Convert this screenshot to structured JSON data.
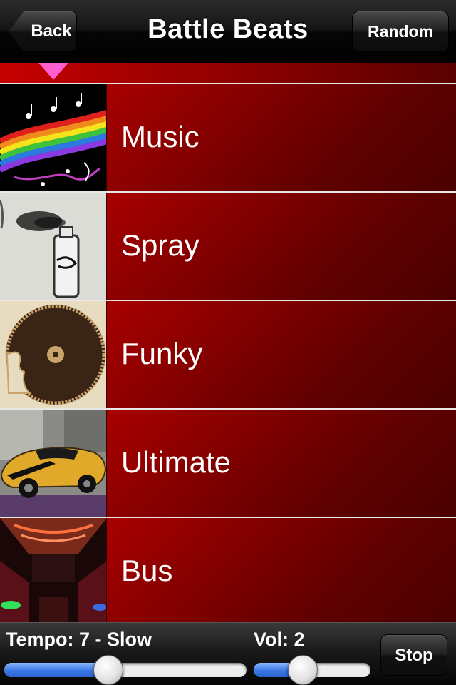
{
  "navbar": {
    "title": "Battle Beats",
    "back_label": "Back",
    "random_label": "Random"
  },
  "list": {
    "items": [
      {
        "label": "Music",
        "image": "rainbow-music-notes-image"
      },
      {
        "label": "Spray",
        "image": "spray-can-graffiti-image"
      },
      {
        "label": "Funky",
        "image": "funky-vinyl-record-face-image"
      },
      {
        "label": "Ultimate",
        "image": "yellow-sports-car-image"
      },
      {
        "label": "Bus",
        "image": "party-bus-interior-image"
      }
    ]
  },
  "controls": {
    "tempo_label": "Tempo: 7 - Slow",
    "tempo_level": 0.43,
    "vol_label": "Vol: 2",
    "vol_level": 0.42,
    "stop_label": "Stop"
  },
  "colors": {
    "row_red": "#c30000",
    "row_dark": "#4a0000",
    "indicator_pink": "#ff5fcf",
    "slider_blue": "#3a78e6"
  }
}
